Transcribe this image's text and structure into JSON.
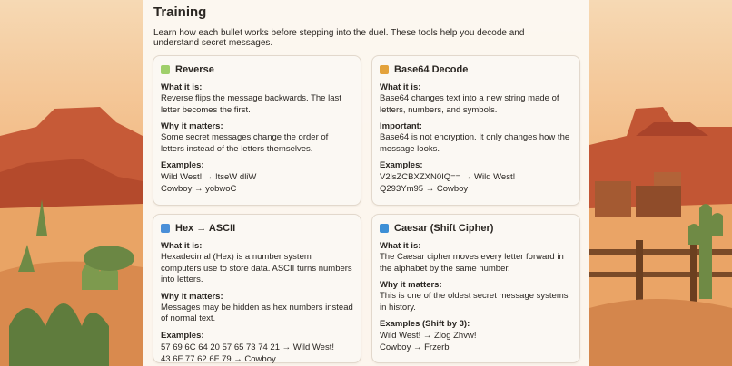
{
  "page": {
    "title": "Training",
    "intro": "Learn how each bullet works before stepping into the duel. These tools help you decode and understand secret messages."
  },
  "cards": [
    {
      "icon": "reverse-icon",
      "title": "Reverse",
      "what_label": "What it is:",
      "what_text": "Reverse flips the message backwards. The last letter becomes the first.",
      "why_label": "Why it matters:",
      "why_text": "Some secret messages change the order of letters instead of the letters themselves.",
      "examples_label": "Examples:",
      "examples": [
        "Wild West! → !tseW dliW",
        "Cowboy → yobwoC"
      ]
    },
    {
      "icon": "lock-icon",
      "title": "Base64 Decode",
      "what_label": "What it is:",
      "what_text": "Base64 changes text into a new string made of letters, numbers, and symbols.",
      "why_label": "Important:",
      "why_text": "Base64 is not encryption. It only changes how the message looks.",
      "examples_label": "Examples:",
      "examples": [
        "V2lsZCBXZXN0IQ== → Wild West!",
        "Q293Ym95 → Cowboy"
      ]
    },
    {
      "icon": "hex-icon",
      "title": "Hex → ASCII",
      "what_label": "What it is:",
      "what_text": "Hexadecimal (Hex) is a number system computers use to store data. ASCII turns numbers into letters.",
      "why_label": "Why it matters:",
      "why_text": "Messages may be hidden as hex numbers instead of normal text.",
      "examples_label": "Examples:",
      "examples": [
        "57 69 6C 64 20 57 65 73 74 21 → Wild West!",
        "43 6F 77 62 6F 79 → Cowboy"
      ]
    },
    {
      "icon": "cycle-icon",
      "title": "Caesar (Shift Cipher)",
      "what_label": "What it is:",
      "what_text": "The Caesar cipher moves every letter forward in the alphabet by the same number.",
      "why_label": "Why it matters:",
      "why_text": "This is one of the oldest secret message systems in history.",
      "examples_label": "Examples (Shift by 3):",
      "examples": [
        "Wild West! → Zlog Zhvw!",
        "Cowboy → Frzerb"
      ]
    }
  ],
  "colors": {
    "reverse_icon": "#9fcf6a",
    "lock_icon": "#e3a23b",
    "hex_icon": "#4a8fd8",
    "cycle_icon": "#3d8fd6"
  }
}
